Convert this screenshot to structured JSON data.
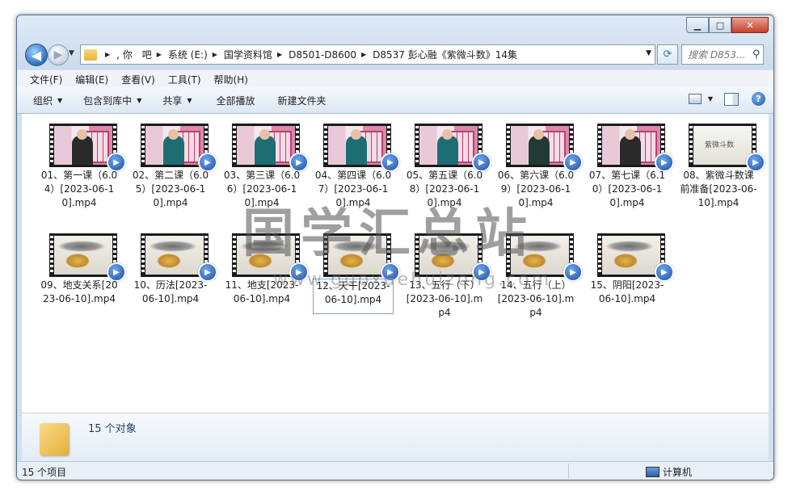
{
  "window": {
    "controls": {
      "minimize": "▁",
      "maximize": "□",
      "close": "✕"
    }
  },
  "nav": {
    "breadcrumbs": [
      ", 你　吧",
      "系统 (E:)",
      "国学资料馆",
      "D8501-D8600",
      "D8537 彭心融《紫微斗数》14集"
    ],
    "search_placeholder": "搜索 D853..."
  },
  "menu": {
    "items": [
      "文件(F)",
      "编辑(E)",
      "查看(V)",
      "工具(T)",
      "帮助(H)"
    ]
  },
  "toolbar": {
    "organize": "组织",
    "include_in_library": "包含到库中",
    "share": "共享",
    "play_all": "全部播放",
    "new_folder": "新建文件夹"
  },
  "files": [
    {
      "name": "01、第一课（6.04）[2023-06-10].mp4",
      "thumb": "class",
      "shirt": "#2a2a2a"
    },
    {
      "name": "02、第二课（6.05）[2023-06-10].mp4",
      "thumb": "class",
      "shirt": "#1d6d72"
    },
    {
      "name": "03、第三课（6.06）[2023-06-10].mp4",
      "thumb": "class",
      "shirt": "#1d6d72"
    },
    {
      "name": "04、第四课（6.07）[2023-06-10].mp4",
      "thumb": "class",
      "shirt": "#1d6d72"
    },
    {
      "name": "05、第五课（6.08）[2023-06-10].mp4",
      "thumb": "class",
      "shirt": "#1d6d72"
    },
    {
      "name": "06、第六课（6.09）[2023-06-10].mp4",
      "thumb": "class",
      "shirt": "#223a34"
    },
    {
      "name": "07、第七课（6.10）[2023-06-10].mp4",
      "thumb": "class",
      "shirt": "#2a2a2a"
    },
    {
      "name": "08、紫微斗数课前准备[2023-06-10].mp4",
      "thumb": "title",
      "thumb_text": "紫微斗数"
    },
    {
      "name": "09、地支关系[2023-06-10].mp4",
      "thumb": "paint"
    },
    {
      "name": "10、历法[2023-06-10].mp4",
      "thumb": "paint"
    },
    {
      "name": "11、地支[2023-06-10].mp4",
      "thumb": "paint"
    },
    {
      "name": "12、天干[2023-06-10].mp4",
      "thumb": "paint",
      "selected": true
    },
    {
      "name": "13、五行（下）[2023-06-10].mp4",
      "thumb": "paint"
    },
    {
      "name": "14、五行（上）[2023-06-10].mp4",
      "thumb": "paint"
    },
    {
      "name": "15、阴阳[2023-06-10].mp4",
      "thumb": "paint"
    }
  ],
  "details": {
    "object_count": "15 个对象"
  },
  "status": {
    "item_count": "15 个项目",
    "location": "计算机"
  },
  "watermark": {
    "main": "国学汇总站",
    "url": "www.guoxuehuizong.com"
  }
}
